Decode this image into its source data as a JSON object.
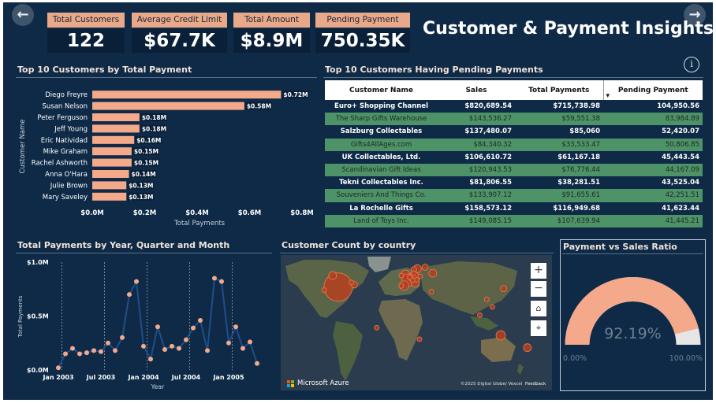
{
  "nav": {
    "back": "←",
    "forward": "→"
  },
  "kpis": [
    {
      "label": "Total Customers",
      "value": "122"
    },
    {
      "label": "Average Credit Limit",
      "value": "$67.7K"
    },
    {
      "label": "Total Amount",
      "value": "$8.9M"
    },
    {
      "label": "Pending Payment",
      "value": "750.35K"
    }
  ],
  "page_title": "Customer & Payment Insights",
  "info_icon": "i",
  "colors": {
    "background": "#0e2a47",
    "accent": "#f4a98a",
    "line": "#1f4e8c",
    "table_green": "#4e9267"
  },
  "pending_table": {
    "title": "Top 10 Customers Having Pending Payments",
    "columns": [
      "Customer Name",
      "Sales",
      "Total Payments",
      "Pending Payment"
    ],
    "sort_indicator": "▾",
    "rows": [
      [
        "Euro+ Shopping Channel",
        "$820,689.54",
        "$715,738.98",
        "104,950.56"
      ],
      [
        "The Sharp Gifts Warehouse",
        "$143,536.27",
        "$59,551.38",
        "83,984.89"
      ],
      [
        "Salzburg Collectables",
        "$137,480.07",
        "$85,060",
        "52,420.07"
      ],
      [
        "Gifts4AllAges.com",
        "$84,340.32",
        "$33,533.47",
        "50,806.85"
      ],
      [
        "UK Collectables, Ltd.",
        "$106,610.72",
        "$61,167.18",
        "45,443.54"
      ],
      [
        "Scandinavian Gift Ideas",
        "$120,943.53",
        "$76,776.44",
        "44,167.09"
      ],
      [
        "Tekni Collectables Inc.",
        "$81,806.55",
        "$38,281.51",
        "43,525.04"
      ],
      [
        "Souveniers And Things Co.",
        "$133,907.12",
        "$91,655.61",
        "42,251.51"
      ],
      [
        "La Rochelle Gifts",
        "$158,573.12",
        "$116,949.68",
        "41,623.44"
      ],
      [
        "Land of Toys Inc.",
        "$149,085.15",
        "$107,639.94",
        "41,445.21"
      ]
    ]
  },
  "map": {
    "title": "Customer Count by country",
    "attribution": "Microsoft Azure",
    "copyright": "©2025 Digital Globe/ Vexcel",
    "feedback": "Feedback",
    "controls": [
      "+",
      "−",
      "⌂",
      "⌖"
    ],
    "bubbles": [
      {
        "lon": -98,
        "lat": 38,
        "size": 36
      },
      {
        "lon": -75,
        "lat": 41,
        "size": 8
      },
      {
        "lon": -118,
        "lat": 34,
        "size": 6
      },
      {
        "lon": -79,
        "lat": 44,
        "size": 6
      },
      {
        "lon": -106,
        "lat": 53,
        "size": 10
      },
      {
        "lon": -2,
        "lat": 54,
        "size": 12
      },
      {
        "lon": 2,
        "lat": 47,
        "size": 16
      },
      {
        "lon": 10,
        "lat": 51,
        "size": 14
      },
      {
        "lon": 15,
        "lat": 62,
        "size": 10
      },
      {
        "lon": 26,
        "lat": 64,
        "size": 8
      },
      {
        "lon": 10,
        "lat": 61,
        "size": 7
      },
      {
        "lon": -8,
        "lat": 53,
        "size": 6
      },
      {
        "lon": -4,
        "lat": 40,
        "size": 12
      },
      {
        "lon": -8,
        "lat": 39.5,
        "size": 6
      },
      {
        "lon": 12,
        "lat": 43,
        "size": 10
      },
      {
        "lon": 14,
        "lat": 47.5,
        "size": 6
      },
      {
        "lon": 8,
        "lat": 47,
        "size": 6
      },
      {
        "lon": 5,
        "lat": 52,
        "size": 6
      },
      {
        "lon": 4,
        "lat": 50.8,
        "size": 6
      },
      {
        "lon": 10,
        "lat": 56,
        "size": 6
      },
      {
        "lon": 19,
        "lat": 52,
        "size": 6
      },
      {
        "lon": 37,
        "lat": 56,
        "size": 10
      },
      {
        "lon": -43,
        "lat": -15,
        "size": 6
      },
      {
        "lon": 18,
        "lat": -30,
        "size": 6
      },
      {
        "lon": 35,
        "lat": 32,
        "size": 6
      },
      {
        "lon": 104,
        "lat": 1.4,
        "size": 6
      },
      {
        "lon": 122,
        "lat": 12,
        "size": 6
      },
      {
        "lon": 114,
        "lat": 22,
        "size": 6
      },
      {
        "lon": 138,
        "lat": 36,
        "size": 8
      },
      {
        "lon": 134,
        "lat": -25,
        "size": 12
      },
      {
        "lon": 172,
        "lat": -41,
        "size": 10
      }
    ]
  },
  "chart_data": [
    {
      "type": "bar",
      "orientation": "horizontal",
      "title": "Top 10 Customers by Total Payment",
      "xlabel": "Total Payments",
      "ylabel": "Customer Name",
      "categories": [
        "Diego Freyre",
        "Susan Nelson",
        "Peter Ferguson",
        "Jeff Young",
        "Eric Natividad",
        "Mike Graham",
        "Rachel Ashworth",
        "Anna O'Hara",
        "Julie Brown",
        "Mary Saveley"
      ],
      "values": [
        0.72,
        0.58,
        0.18,
        0.18,
        0.16,
        0.15,
        0.15,
        0.14,
        0.13,
        0.13
      ],
      "data_labels": [
        "$0.72M",
        "$0.58M",
        "$0.18M",
        "$0.18M",
        "$0.16M",
        "$0.15M",
        "$0.15M",
        "$0.14M",
        "$0.13M",
        "$0.13M"
      ],
      "xticks": [
        "$0.0M",
        "$0.2M",
        "$0.4M",
        "$0.6M",
        "$0.8M"
      ],
      "xlim": [
        0,
        0.8
      ],
      "color": "#f4a98a"
    },
    {
      "type": "line",
      "title": "Total Payments by Year, Quarter and Month",
      "xlabel": "Year",
      "ylabel": "Total Payments",
      "xticks": [
        "Jan 2003",
        "Jul 2003",
        "Jan 2004",
        "Jul 2004",
        "Jan 2005"
      ],
      "yticks": [
        "$0.0M",
        "$0.5M",
        "$1.0M"
      ],
      "ylim": [
        0,
        1.0
      ],
      "values": [
        0.02,
        0.15,
        0.2,
        0.15,
        0.16,
        0.18,
        0.17,
        0.25,
        0.18,
        0.3,
        0.7,
        0.82,
        0.22,
        0.1,
        0.4,
        0.19,
        0.22,
        0.2,
        0.28,
        0.39,
        0.46,
        0.18,
        0.85,
        0.82,
        0.25,
        0.4,
        0.2,
        0.26,
        0.06
      ],
      "line_color": "#1f4e8c",
      "marker_color": "#f4a98a",
      "grid": false
    },
    {
      "type": "gauge",
      "title": "Payment vs Sales Ratio",
      "value": 92.19,
      "value_label": "92.19%",
      "min_label": "0.00%",
      "max_label": "100.00%",
      "range": [
        0,
        100
      ]
    }
  ]
}
